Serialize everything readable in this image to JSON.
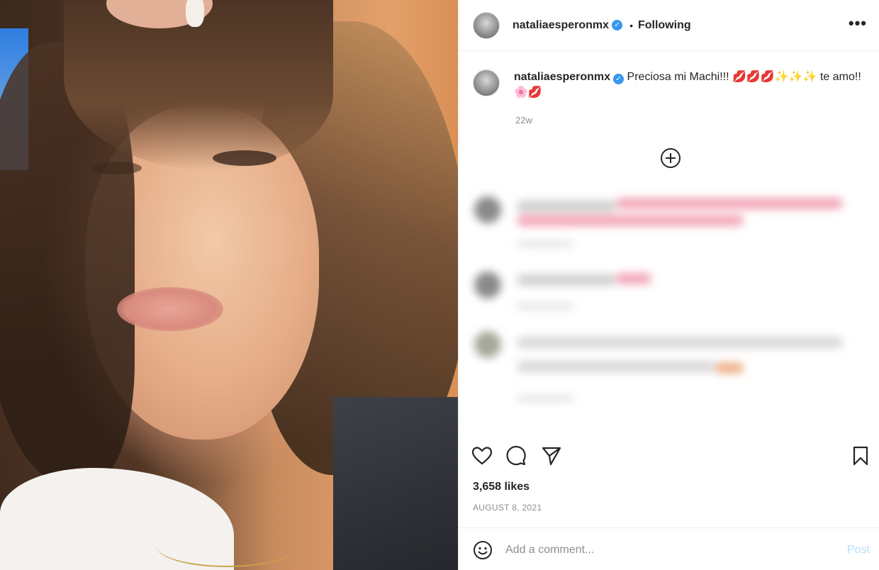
{
  "header": {
    "username": "nataliaesperonmx",
    "separator": "•",
    "follow_status": "Following"
  },
  "caption": {
    "username": "nataliaesperonmx",
    "text": "Preciosa mi Machi!!! 💋💋💋✨✨✨ te amo!!🌸💋",
    "age": "22w"
  },
  "post": {
    "likes": "3,658 likes",
    "date": "AUGUST 8, 2021"
  },
  "comment": {
    "placeholder": "Add a comment...",
    "post_label": "Post"
  },
  "colors": {
    "verified": "#3897f0",
    "post_disabled": "#b2dffc",
    "muted": "#8e8e8e"
  },
  "icons": [
    "more-icon",
    "load-more-icon",
    "heart-icon",
    "comment-icon",
    "share-icon",
    "save-icon",
    "emoji-icon",
    "verified-icon"
  ]
}
